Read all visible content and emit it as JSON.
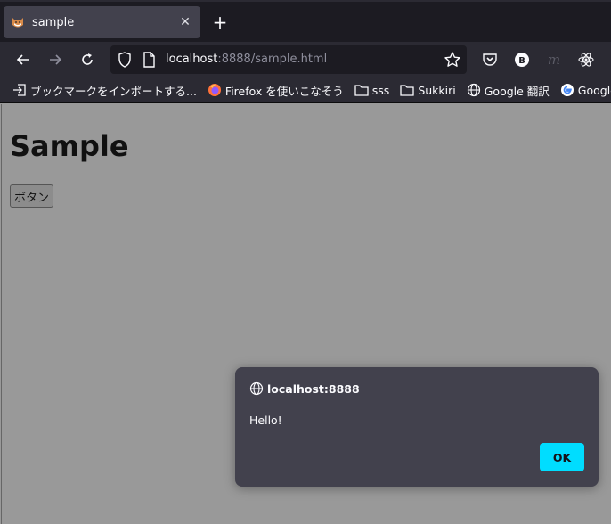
{
  "tab": {
    "title": "sample",
    "close_glyph": "✕"
  },
  "newtab_glyph": "+",
  "toolbar": {
    "url_host": "localhost",
    "url_rest": ":8888/sample.html",
    "ext_b_label": "B",
    "ext_m_label": "m"
  },
  "bookmarks": [
    {
      "label": "ブックマークをインポートする...",
      "icon": "import-icon"
    },
    {
      "label": "Firefox を使いこなそう",
      "icon": "firefox-icon"
    },
    {
      "label": "sss",
      "icon": "folder-icon"
    },
    {
      "label": "Sukkiri",
      "icon": "folder-icon"
    },
    {
      "label": "Google 翻訳",
      "icon": "globe-icon"
    },
    {
      "label": "Google",
      "icon": "google-icon"
    }
  ],
  "page": {
    "heading": "Sample",
    "button_label": "ボタン"
  },
  "dialog": {
    "origin": "localhost:8888",
    "message": "Hello!",
    "ok_label": "OK"
  },
  "colors": {
    "accent": "#00ddff",
    "dialog_bg": "#42414d",
    "page_bg": "#999999"
  }
}
